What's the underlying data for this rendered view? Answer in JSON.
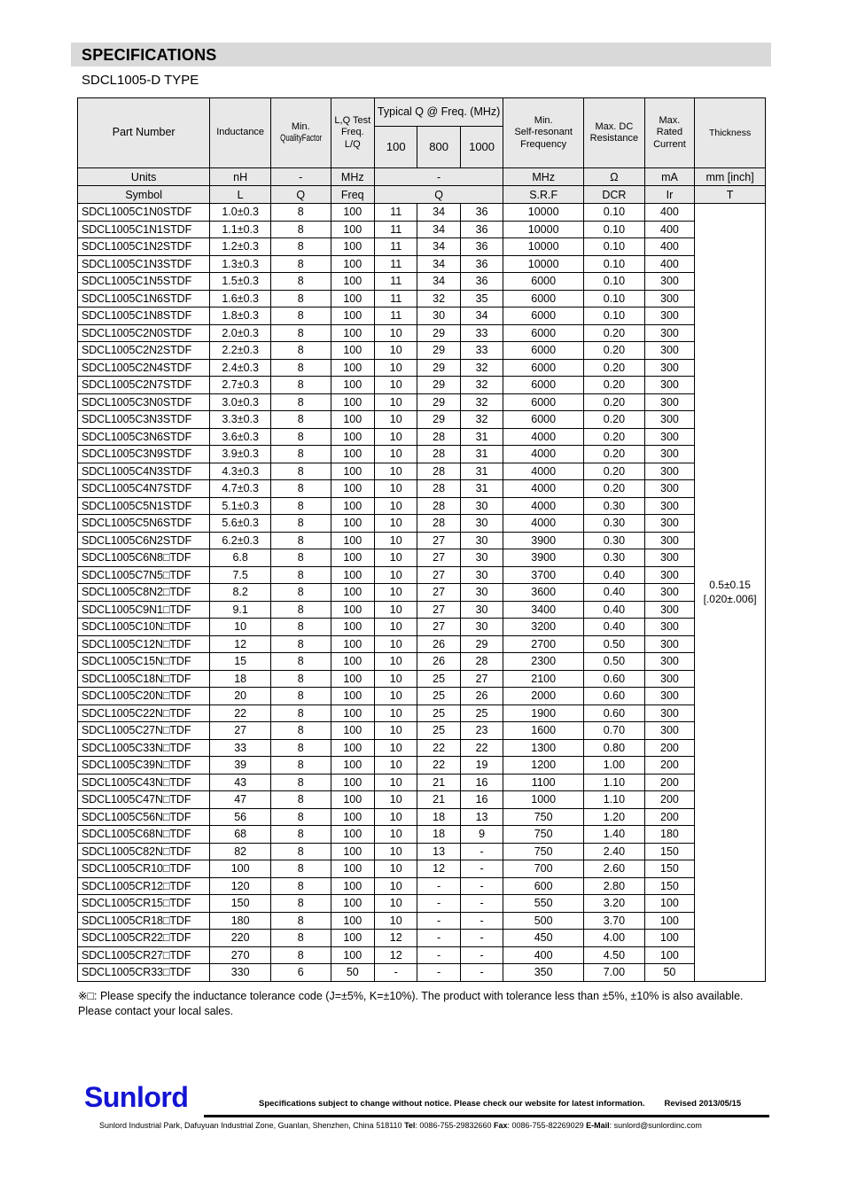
{
  "section": {
    "title": "SPECIFICATIONS",
    "type_line": "SDCL1005-D TYPE"
  },
  "table": {
    "headers": {
      "part_number": "Part Number",
      "inductance": "Inductance",
      "min_quality_factor_l1": "Min.",
      "min_quality_factor_l2": "QualityFactor",
      "lq_test_l1": "L,Q Test",
      "lq_test_l2": "Freq.",
      "lq_test_l3": "L/Q",
      "typical_q_group": "Typical Q @ Freq. (MHz)",
      "q_100": "100",
      "q_800": "800",
      "q_1000": "1000",
      "srf_l1": "Min.",
      "srf_l2": "Self-resonant",
      "srf_l3": "Frequency",
      "dcr_l1": "Max. DC",
      "dcr_l2": "Resistance",
      "ir_l1": "Max.",
      "ir_l2": "Rated",
      "ir_l3": "Current",
      "thickness": "Thickness"
    },
    "units_row": {
      "label": "Units",
      "inductance": "nH",
      "q": "-",
      "freq": "MHz",
      "typical_q": "-",
      "srf": "MHz",
      "dcr": "Ω",
      "ir": "mA",
      "thickness": "mm [inch]"
    },
    "symbol_row": {
      "label": "Symbol",
      "inductance": "L",
      "q": "Q",
      "freq": "Freq",
      "typical_q": "Q",
      "srf": "S.R.F",
      "dcr": "DCR",
      "ir": "Ir",
      "thickness": "T"
    },
    "thickness_value_l1": "0.5±0.15",
    "thickness_value_l2": "[.020±.006]",
    "rows": [
      {
        "pn": "SDCL1005C1N0STDF",
        "l": "1.0±0.3",
        "q": "8",
        "freq": "100",
        "q100": "11",
        "q800": "34",
        "q1000": "36",
        "srf": "10000",
        "dcr": "0.10",
        "ir": "400"
      },
      {
        "pn": "SDCL1005C1N1STDF",
        "l": "1.1±0.3",
        "q": "8",
        "freq": "100",
        "q100": "11",
        "q800": "34",
        "q1000": "36",
        "srf": "10000",
        "dcr": "0.10",
        "ir": "400"
      },
      {
        "pn": "SDCL1005C1N2STDF",
        "l": "1.2±0.3",
        "q": "8",
        "freq": "100",
        "q100": "11",
        "q800": "34",
        "q1000": "36",
        "srf": "10000",
        "dcr": "0.10",
        "ir": "400"
      },
      {
        "pn": "SDCL1005C1N3STDF",
        "l": "1.3±0.3",
        "q": "8",
        "freq": "100",
        "q100": "11",
        "q800": "34",
        "q1000": "36",
        "srf": "10000",
        "dcr": "0.10",
        "ir": "400"
      },
      {
        "pn": "SDCL1005C1N5STDF",
        "l": "1.5±0.3",
        "q": "8",
        "freq": "100",
        "q100": "11",
        "q800": "34",
        "q1000": "36",
        "srf": "6000",
        "dcr": "0.10",
        "ir": "300"
      },
      {
        "pn": "SDCL1005C1N6STDF",
        "l": "1.6±0.3",
        "q": "8",
        "freq": "100",
        "q100": "11",
        "q800": "32",
        "q1000": "35",
        "srf": "6000",
        "dcr": "0.10",
        "ir": "300"
      },
      {
        "pn": "SDCL1005C1N8STDF",
        "l": "1.8±0.3",
        "q": "8",
        "freq": "100",
        "q100": "11",
        "q800": "30",
        "q1000": "34",
        "srf": "6000",
        "dcr": "0.10",
        "ir": "300"
      },
      {
        "pn": "SDCL1005C2N0STDF",
        "l": "2.0±0.3",
        "q": "8",
        "freq": "100",
        "q100": "10",
        "q800": "29",
        "q1000": "33",
        "srf": "6000",
        "dcr": "0.20",
        "ir": "300"
      },
      {
        "pn": "SDCL1005C2N2STDF",
        "l": "2.2±0.3",
        "q": "8",
        "freq": "100",
        "q100": "10",
        "q800": "29",
        "q1000": "33",
        "srf": "6000",
        "dcr": "0.20",
        "ir": "300"
      },
      {
        "pn": "SDCL1005C2N4STDF",
        "l": "2.4±0.3",
        "q": "8",
        "freq": "100",
        "q100": "10",
        "q800": "29",
        "q1000": "32",
        "srf": "6000",
        "dcr": "0.20",
        "ir": "300"
      },
      {
        "pn": "SDCL1005C2N7STDF",
        "l": "2.7±0.3",
        "q": "8",
        "freq": "100",
        "q100": "10",
        "q800": "29",
        "q1000": "32",
        "srf": "6000",
        "dcr": "0.20",
        "ir": "300"
      },
      {
        "pn": "SDCL1005C3N0STDF",
        "l": "3.0±0.3",
        "q": "8",
        "freq": "100",
        "q100": "10",
        "q800": "29",
        "q1000": "32",
        "srf": "6000",
        "dcr": "0.20",
        "ir": "300"
      },
      {
        "pn": "SDCL1005C3N3STDF",
        "l": "3.3±0.3",
        "q": "8",
        "freq": "100",
        "q100": "10",
        "q800": "29",
        "q1000": "32",
        "srf": "6000",
        "dcr": "0.20",
        "ir": "300"
      },
      {
        "pn": "SDCL1005C3N6STDF",
        "l": "3.6±0.3",
        "q": "8",
        "freq": "100",
        "q100": "10",
        "q800": "28",
        "q1000": "31",
        "srf": "4000",
        "dcr": "0.20",
        "ir": "300"
      },
      {
        "pn": "SDCL1005C3N9STDF",
        "l": "3.9±0.3",
        "q": "8",
        "freq": "100",
        "q100": "10",
        "q800": "28",
        "q1000": "31",
        "srf": "4000",
        "dcr": "0.20",
        "ir": "300"
      },
      {
        "pn": "SDCL1005C4N3STDF",
        "l": "4.3±0.3",
        "q": "8",
        "freq": "100",
        "q100": "10",
        "q800": "28",
        "q1000": "31",
        "srf": "4000",
        "dcr": "0.20",
        "ir": "300"
      },
      {
        "pn": "SDCL1005C4N7STDF",
        "l": "4.7±0.3",
        "q": "8",
        "freq": "100",
        "q100": "10",
        "q800": "28",
        "q1000": "31",
        "srf": "4000",
        "dcr": "0.20",
        "ir": "300"
      },
      {
        "pn": "SDCL1005C5N1STDF",
        "l": "5.1±0.3",
        "q": "8",
        "freq": "100",
        "q100": "10",
        "q800": "28",
        "q1000": "30",
        "srf": "4000",
        "dcr": "0.30",
        "ir": "300"
      },
      {
        "pn": "SDCL1005C5N6STDF",
        "l": "5.6±0.3",
        "q": "8",
        "freq": "100",
        "q100": "10",
        "q800": "28",
        "q1000": "30",
        "srf": "4000",
        "dcr": "0.30",
        "ir": "300"
      },
      {
        "pn": "SDCL1005C6N2STDF",
        "l": "6.2±0.3",
        "q": "8",
        "freq": "100",
        "q100": "10",
        "q800": "27",
        "q1000": "30",
        "srf": "3900",
        "dcr": "0.30",
        "ir": "300"
      },
      {
        "pn": "SDCL1005C6N8□TDF",
        "l": "6.8",
        "q": "8",
        "freq": "100",
        "q100": "10",
        "q800": "27",
        "q1000": "30",
        "srf": "3900",
        "dcr": "0.30",
        "ir": "300"
      },
      {
        "pn": "SDCL1005C7N5□TDF",
        "l": "7.5",
        "q": "8",
        "freq": "100",
        "q100": "10",
        "q800": "27",
        "q1000": "30",
        "srf": "3700",
        "dcr": "0.40",
        "ir": "300"
      },
      {
        "pn": "SDCL1005C8N2□TDF",
        "l": "8.2",
        "q": "8",
        "freq": "100",
        "q100": "10",
        "q800": "27",
        "q1000": "30",
        "srf": "3600",
        "dcr": "0.40",
        "ir": "300"
      },
      {
        "pn": "SDCL1005C9N1□TDF",
        "l": "9.1",
        "q": "8",
        "freq": "100",
        "q100": "10",
        "q800": "27",
        "q1000": "30",
        "srf": "3400",
        "dcr": "0.40",
        "ir": "300"
      },
      {
        "pn": "SDCL1005C10N□TDF",
        "l": "10",
        "q": "8",
        "freq": "100",
        "q100": "10",
        "q800": "27",
        "q1000": "30",
        "srf": "3200",
        "dcr": "0.40",
        "ir": "300"
      },
      {
        "pn": "SDCL1005C12N□TDF",
        "l": "12",
        "q": "8",
        "freq": "100",
        "q100": "10",
        "q800": "26",
        "q1000": "29",
        "srf": "2700",
        "dcr": "0.50",
        "ir": "300"
      },
      {
        "pn": "SDCL1005C15N□TDF",
        "l": "15",
        "q": "8",
        "freq": "100",
        "q100": "10",
        "q800": "26",
        "q1000": "28",
        "srf": "2300",
        "dcr": "0.50",
        "ir": "300"
      },
      {
        "pn": "SDCL1005C18N□TDF",
        "l": "18",
        "q": "8",
        "freq": "100",
        "q100": "10",
        "q800": "25",
        "q1000": "27",
        "srf": "2100",
        "dcr": "0.60",
        "ir": "300"
      },
      {
        "pn": "SDCL1005C20N□TDF",
        "l": "20",
        "q": "8",
        "freq": "100",
        "q100": "10",
        "q800": "25",
        "q1000": "26",
        "srf": "2000",
        "dcr": "0.60",
        "ir": "300"
      },
      {
        "pn": "SDCL1005C22N□TDF",
        "l": "22",
        "q": "8",
        "freq": "100",
        "q100": "10",
        "q800": "25",
        "q1000": "25",
        "srf": "1900",
        "dcr": "0.60",
        "ir": "300"
      },
      {
        "pn": "SDCL1005C27N□TDF",
        "l": "27",
        "q": "8",
        "freq": "100",
        "q100": "10",
        "q800": "25",
        "q1000": "23",
        "srf": "1600",
        "dcr": "0.70",
        "ir": "300"
      },
      {
        "pn": "SDCL1005C33N□TDF",
        "l": "33",
        "q": "8",
        "freq": "100",
        "q100": "10",
        "q800": "22",
        "q1000": "22",
        "srf": "1300",
        "dcr": "0.80",
        "ir": "200"
      },
      {
        "pn": "SDCL1005C39N□TDF",
        "l": "39",
        "q": "8",
        "freq": "100",
        "q100": "10",
        "q800": "22",
        "q1000": "19",
        "srf": "1200",
        "dcr": "1.00",
        "ir": "200"
      },
      {
        "pn": "SDCL1005C43N□TDF",
        "l": "43",
        "q": "8",
        "freq": "100",
        "q100": "10",
        "q800": "21",
        "q1000": "16",
        "srf": "1100",
        "dcr": "1.10",
        "ir": "200"
      },
      {
        "pn": "SDCL1005C47N□TDF",
        "l": "47",
        "q": "8",
        "freq": "100",
        "q100": "10",
        "q800": "21",
        "q1000": "16",
        "srf": "1000",
        "dcr": "1.10",
        "ir": "200"
      },
      {
        "pn": "SDCL1005C56N□TDF",
        "l": "56",
        "q": "8",
        "freq": "100",
        "q100": "10",
        "q800": "18",
        "q1000": "13",
        "srf": "750",
        "dcr": "1.20",
        "ir": "200"
      },
      {
        "pn": "SDCL1005C68N□TDF",
        "l": "68",
        "q": "8",
        "freq": "100",
        "q100": "10",
        "q800": "18",
        "q1000": "9",
        "srf": "750",
        "dcr": "1.40",
        "ir": "180"
      },
      {
        "pn": "SDCL1005C82N□TDF",
        "l": "82",
        "q": "8",
        "freq": "100",
        "q100": "10",
        "q800": "13",
        "q1000": "-",
        "srf": "750",
        "dcr": "2.40",
        "ir": "150"
      },
      {
        "pn": "SDCL1005CR10□TDF",
        "l": "100",
        "q": "8",
        "freq": "100",
        "q100": "10",
        "q800": "12",
        "q1000": "-",
        "srf": "700",
        "dcr": "2.60",
        "ir": "150"
      },
      {
        "pn": "SDCL1005CR12□TDF",
        "l": "120",
        "q": "8",
        "freq": "100",
        "q100": "10",
        "q800": "-",
        "q1000": "-",
        "srf": "600",
        "dcr": "2.80",
        "ir": "150"
      },
      {
        "pn": "SDCL1005CR15□TDF",
        "l": "150",
        "q": "8",
        "freq": "100",
        "q100": "10",
        "q800": "-",
        "q1000": "-",
        "srf": "550",
        "dcr": "3.20",
        "ir": "100"
      },
      {
        "pn": "SDCL1005CR18□TDF",
        "l": "180",
        "q": "8",
        "freq": "100",
        "q100": "10",
        "q800": "-",
        "q1000": "-",
        "srf": "500",
        "dcr": "3.70",
        "ir": "100"
      },
      {
        "pn": "SDCL1005CR22□TDF",
        "l": "220",
        "q": "8",
        "freq": "100",
        "q100": "12",
        "q800": "-",
        "q1000": "-",
        "srf": "450",
        "dcr": "4.00",
        "ir": "100"
      },
      {
        "pn": "SDCL1005CR27□TDF",
        "l": "270",
        "q": "8",
        "freq": "100",
        "q100": "12",
        "q800": "-",
        "q1000": "-",
        "srf": "400",
        "dcr": "4.50",
        "ir": "100"
      },
      {
        "pn": "SDCL1005CR33□TDF",
        "l": "330",
        "q": "6",
        "freq": "50",
        "q100": "-",
        "q800": "-",
        "q1000": "-",
        "srf": "350",
        "dcr": "7.00",
        "ir": "50"
      }
    ]
  },
  "note": {
    "text": "※□: Please specify the inductance tolerance code (J=±5%, K=±10%). The product with tolerance less than ±5%, ±10% is also available. Please contact your local sales."
  },
  "footer": {
    "logo": "Sunlord",
    "disclaimer": "Specifications subject to change without notice. Please check our website for latest information.",
    "revision": "Revised 2013/05/15",
    "address": "Sunlord Industrial Park, Dafuyuan Industrial Zone, Guanlan, Shenzhen, China 518110",
    "tel_label": "Tel",
    "tel": ": 0086-755-29832660",
    "fax_label": "Fax",
    "fax": ": 0086-755-82269029",
    "email_label": "E-Mail",
    "email": ": sunlord@sunlordinc.com",
    "logo_color": "#1414d2"
  }
}
